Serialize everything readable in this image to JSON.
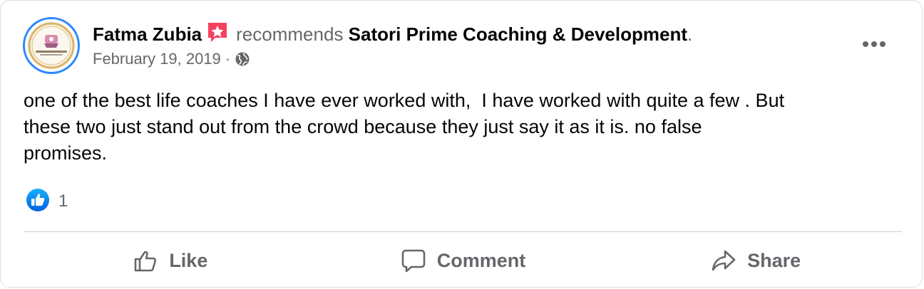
{
  "post": {
    "author": "Fatma Zubia",
    "verb": "recommends",
    "page_name": "Satori Prime Coaching & Development",
    "trailing_period": ".",
    "date": "February 19, 2019",
    "date_separator": "·",
    "audience_icon": "globe-icon",
    "badge_icon": "recommendation-star-icon",
    "text": "one of the best life coaches I have ever worked with,  I have worked with quite a few . But\nthese two just stand out from the crowd because they just say it as it is. no false\npromises."
  },
  "reactions": {
    "icon": "like-reaction-icon",
    "count": "1"
  },
  "actions": {
    "like_label": "Like",
    "comment_label": "Comment",
    "share_label": "Share"
  },
  "colors": {
    "accent_blue": "#2d88ff",
    "badge_red": "#f3425f",
    "secondary_text": "#65676b",
    "primary_text": "#050505"
  }
}
